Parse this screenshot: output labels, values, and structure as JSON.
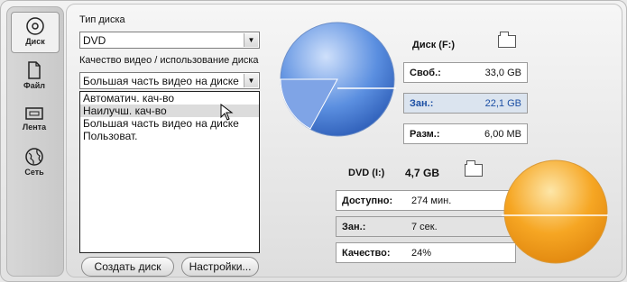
{
  "sidebar": {
    "items": [
      {
        "label": "Диск",
        "icon": "disc-icon",
        "active": true
      },
      {
        "label": "Файл",
        "icon": "file-icon",
        "active": false
      },
      {
        "label": "Лента",
        "icon": "tape-icon",
        "active": false
      },
      {
        "label": "Сеть",
        "icon": "globe-icon",
        "active": false
      }
    ]
  },
  "settings": {
    "disc_type_label": "Тип диска",
    "disc_type_value": "DVD",
    "quality_label": "Качество видео / использование диска",
    "quality_value": "Большая часть видео на диске",
    "quality_options": [
      "Автоматич. кач-во",
      "Наилучш. кач-во",
      "Большая часть видео на диске",
      "Пользоват."
    ],
    "highlighted_option_index": 1
  },
  "buttons": {
    "create": "Создать диск",
    "settings": "Настройки..."
  },
  "disk_f": {
    "title": "Диск (F:)",
    "rows": [
      {
        "key": "Своб.:",
        "value": "33,0 GB"
      },
      {
        "key": "Зан.:",
        "value": "22,1 GB"
      },
      {
        "key": "Разм.:",
        "value": "6,00 MB"
      }
    ],
    "pie_color": "#5b8fe0"
  },
  "dvd": {
    "title": "DVD (I:)",
    "capacity": "4,7 GB",
    "rows": [
      {
        "key": "Доступно:",
        "value": "274 мин."
      },
      {
        "key": "Зан.:",
        "value": "7 сек."
      },
      {
        "key": "Качество:",
        "value": "24%"
      }
    ],
    "pie_color": "#f6a623"
  }
}
